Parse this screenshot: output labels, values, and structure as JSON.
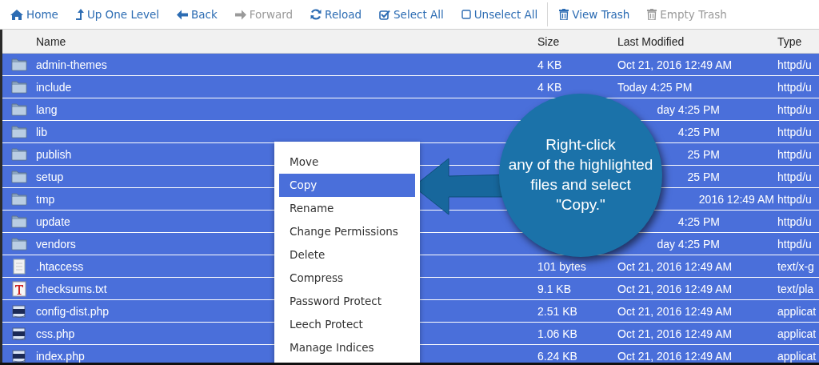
{
  "toolbar": {
    "groups": [
      [
        {
          "label": "Home",
          "kind": "home",
          "disabled": false
        },
        {
          "label": "Up One Level",
          "kind": "up",
          "disabled": false
        },
        {
          "label": "Back",
          "kind": "back",
          "disabled": false
        },
        {
          "label": "Forward",
          "kind": "forward",
          "disabled": true
        },
        {
          "label": "Reload",
          "kind": "reload",
          "disabled": false
        },
        {
          "label": "Select All",
          "kind": "checkbox",
          "disabled": false
        },
        {
          "label": "Unselect All",
          "kind": "square",
          "disabled": false
        }
      ],
      [
        {
          "label": "View Trash",
          "kind": "trash",
          "disabled": false
        },
        {
          "label": "Empty Trash",
          "kind": "trash",
          "disabled": true
        }
      ]
    ]
  },
  "table": {
    "columns": [
      "Name",
      "Size",
      "Last Modified",
      "Type"
    ],
    "rows": [
      {
        "kind": "folder",
        "name": "admin-themes",
        "size": "4 KB",
        "modified": {
          "text": "Oct 21, 2016 12:49 AM",
          "kind": "full"
        },
        "type": "httpd/u",
        "selected": true
      },
      {
        "kind": "folder",
        "name": "include",
        "size": "4 KB",
        "modified": {
          "text": "Today 4:25 PM",
          "kind": "full"
        },
        "type": "httpd/u",
        "selected": true
      },
      {
        "kind": "folder",
        "name": "lang",
        "modified": {
          "text": "day 4:25 PM",
          "kind": "cut"
        },
        "type": "httpd/u",
        "selected": true
      },
      {
        "kind": "folder",
        "name": "lib",
        "modified": {
          "text": "4:25 PM",
          "kind": "cut"
        },
        "type": "httpd/u",
        "selected": true
      },
      {
        "kind": "folder",
        "name": "publish",
        "modified": {
          "text": "25 PM",
          "kind": "cut"
        },
        "type": "httpd/u",
        "selected": true
      },
      {
        "kind": "folder",
        "name": "setup",
        "modified": {
          "text": "25 PM",
          "kind": "cut"
        },
        "type": "httpd/u",
        "selected": true
      },
      {
        "kind": "folder",
        "name": "tmp",
        "modified": {
          "text": "2016 12:49 AM",
          "kind": "cutlong"
        },
        "type": "httpd/u",
        "selected": true
      },
      {
        "kind": "folder",
        "name": "update",
        "modified": {
          "text": "4:25 PM",
          "kind": "cut"
        },
        "type": "httpd/u",
        "selected": true
      },
      {
        "kind": "folder",
        "name": "vendors",
        "modified": {
          "text": "day 4:25 PM",
          "kind": "cut"
        },
        "type": "httpd/u",
        "selected": true
      },
      {
        "kind": "file",
        "name": ".htaccess",
        "size": "101 bytes",
        "modified": {
          "text": "Oct 21, 2016 12:49 AM",
          "kind": "full"
        },
        "type": "text/x-g",
        "selected": true
      },
      {
        "kind": "text",
        "name": "checksums.txt",
        "size": "9.1 KB",
        "modified": {
          "text": "Oct 21, 2016 12:49 AM",
          "kind": "full"
        },
        "type": "text/pla",
        "selected": true
      },
      {
        "kind": "php",
        "name": "config-dist.php",
        "size": "2.51 KB",
        "modified": {
          "text": "Oct 21, 2016 12:49 AM",
          "kind": "full"
        },
        "type": "applicat",
        "selected": true
      },
      {
        "kind": "php",
        "name": "css.php",
        "size": "1.06 KB",
        "modified": {
          "text": "Oct 21, 2016 12:49 AM",
          "kind": "full"
        },
        "type": "applicat",
        "selected": true
      },
      {
        "kind": "php",
        "name": "index.php",
        "size": "6.24 KB",
        "modified": {
          "text": "Oct 21, 2016 12:49 AM",
          "kind": "full"
        },
        "type": "applicat",
        "selected": true
      }
    ]
  },
  "context_menu": {
    "items": [
      {
        "label": "Move",
        "selected": false
      },
      {
        "label": "Copy",
        "selected": true
      },
      {
        "label": "Rename",
        "selected": false
      },
      {
        "label": "Change Permissions",
        "selected": false
      },
      {
        "label": "Delete",
        "selected": false
      },
      {
        "label": "Compress",
        "selected": false
      },
      {
        "label": "Password Protect",
        "selected": false
      },
      {
        "label": "Leech Protect",
        "selected": false
      },
      {
        "label": "Manage Indices",
        "selected": false
      }
    ]
  },
  "callout": {
    "lines": [
      "Right-click",
      "any of the highlighted",
      "files and select",
      "\"Copy.\""
    ]
  }
}
